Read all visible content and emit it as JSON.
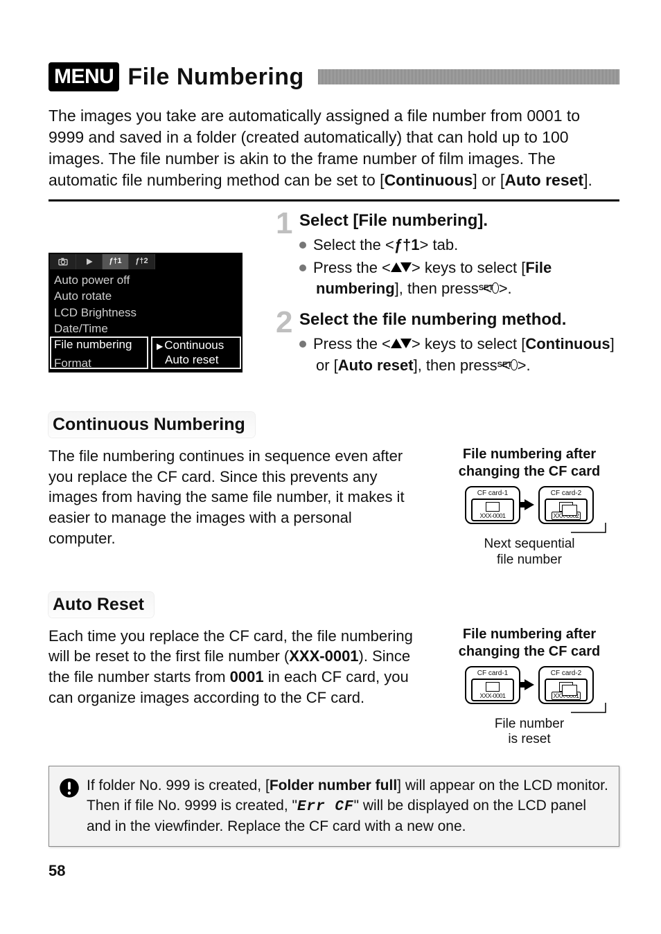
{
  "title": {
    "badge": "MENU",
    "text": "File Numbering"
  },
  "intro": {
    "p": "The images you take are automatically assigned a file number from 0001 to 9999 and saved in a folder (created automatically) that can hold up to 100 images. The file number is akin to the frame number of film images. The automatic file numbering method can be set to [",
    "opt1": "Continuous",
    "mid": "] or [",
    "opt2": "Auto reset",
    "end": "]."
  },
  "lcd": {
    "tabs": {
      "t1": "",
      "t2": "",
      "t3": "ƒ†1",
      "t4": "ƒ†2"
    },
    "lines": {
      "l1": "Auto power off",
      "l2": "Auto rotate",
      "l3": "LCD Brightness",
      "l4": "Date/Time",
      "sel_label": "File numbering",
      "opt1": "Continuous",
      "opt2": "Auto reset",
      "l6": "Format"
    }
  },
  "steps": {
    "s1": {
      "num": "1",
      "title": "Select [File numbering].",
      "b1a": "Select the <",
      "b1b": "ƒ†1",
      "b1c": "> tab.",
      "b2a": "Press the <",
      "b2b": "> keys to select [",
      "b2c": "File numbering",
      "b2d": "], then press <",
      "b2e": ">."
    },
    "s2": {
      "num": "2",
      "title": "Select the file numbering method.",
      "b1a": "Press the <",
      "b1b": "> keys to select [",
      "b1c": "Continuous",
      "b1d": "] or [",
      "b1e": "Auto reset",
      "b1f": "], then press <",
      "b1g": ">."
    },
    "set_label": "SET"
  },
  "cont": {
    "heading": "Continuous Numbering",
    "text": "The file numbering continues in sequence even after you replace the CF card. Since this prevents any images from having the same file number, it makes it easier to manage the images with a personal computer.",
    "fig_title1": "File numbering after",
    "fig_title2": "changing the CF card",
    "card1_label": "CF card-1",
    "card1_file": "XXX-0001",
    "card2_label": "CF card-2",
    "card2_file": "XXX-0002",
    "caption1": "Next sequential",
    "caption2": "file number"
  },
  "auto": {
    "heading": "Auto Reset",
    "t1": "Each time you replace the CF card, the file numbering will be reset to the first file number (",
    "code1": "XXX-0001",
    "t2": "). Since the file number starts from ",
    "code2": "0001",
    "t3": " in each CF card, you can organize images according to the CF card.",
    "fig_title1": "File numbering after",
    "fig_title2": "changing the CF card",
    "card1_label": "CF card-1",
    "card1_file": "XXX-0001",
    "card2_label": "CF card-2",
    "card2_file": "XXX-0001",
    "caption1": "File number",
    "caption2": "is reset"
  },
  "note": {
    "t1": "If folder No. 999 is created, [",
    "bold1": "Folder number full",
    "t2": "] will appear on the LCD monitor. Then if file No. 9999 is created, \"",
    "err": "Err  CF",
    "t3": "\" will be displayed on the LCD panel and in the viewfinder. Replace the CF card with a new one."
  },
  "page_number": "58"
}
